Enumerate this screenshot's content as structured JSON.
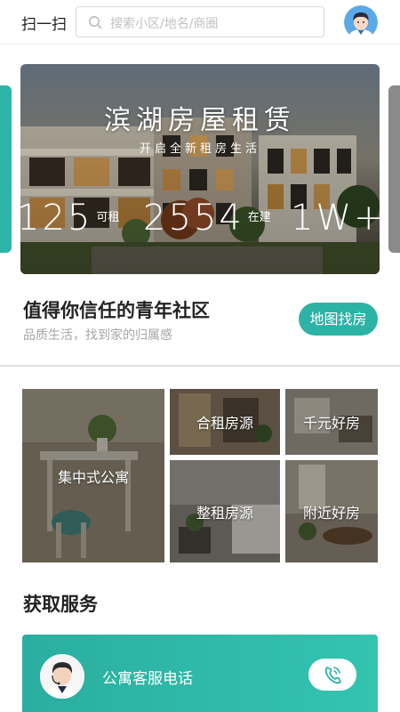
{
  "header": {
    "scan_label": "扫一扫",
    "search_placeholder": "搜索小区/地名/商圈"
  },
  "banner": {
    "title": "滨湖房屋租赁",
    "subtitle": "开启全新租房生活",
    "stats": [
      {
        "value": "125",
        "unit": "可租"
      },
      {
        "value": "2554",
        "unit": "在建"
      },
      {
        "value": "1W+",
        "unit": ""
      }
    ]
  },
  "community": {
    "title": "值得你信任的青年社区",
    "subtitle": "品质生活，找到家的归属感",
    "map_button": "地图找房"
  },
  "categories": [
    {
      "label": "集中式公寓"
    },
    {
      "label": "合租房源"
    },
    {
      "label": "千元好房"
    },
    {
      "label": "整租房源"
    },
    {
      "label": "附近好房"
    }
  ],
  "services": {
    "title": "获取服务",
    "items": [
      {
        "label": "公寓客服电话"
      }
    ]
  },
  "colors": {
    "accent": "#2cb3a6",
    "divider": "#e2e2e2"
  },
  "icons": [
    "search-icon",
    "user-avatar",
    "phone-icon",
    "agent-avatar"
  ]
}
